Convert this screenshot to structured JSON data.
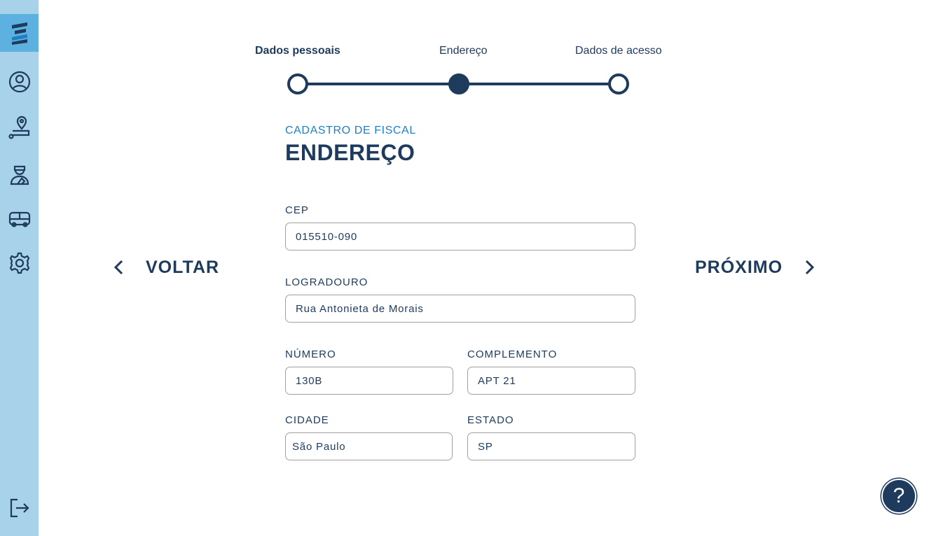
{
  "sidebar": {
    "items": [
      {
        "name": "logo",
        "icon": "brand-logo-icon"
      },
      {
        "name": "profile",
        "icon": "user-circle-icon"
      },
      {
        "name": "location",
        "icon": "map-pin-route-icon"
      },
      {
        "name": "inspector",
        "icon": "inspector-person-icon"
      },
      {
        "name": "bus",
        "icon": "bus-icon"
      },
      {
        "name": "settings",
        "icon": "gear-icon"
      },
      {
        "name": "logout",
        "icon": "logout-icon"
      }
    ]
  },
  "stepper": {
    "steps": [
      {
        "label": "Dados pessoais",
        "state": "completed"
      },
      {
        "label": "Endereço",
        "state": "current"
      },
      {
        "label": "Dados de acesso",
        "state": "upcoming"
      }
    ]
  },
  "form": {
    "subtitle": "CADASTRO DE FISCAL",
    "title": "ENDEREÇO",
    "fields": {
      "cep": {
        "label": "CEP",
        "value": "015510-090"
      },
      "logradouro": {
        "label": "LOGRADOURO",
        "value": "Rua Antonieta de Morais"
      },
      "numero": {
        "label": "NÚMERO",
        "value": "130B"
      },
      "complemento": {
        "label": "COMPLEMENTO",
        "value": "APT 21"
      },
      "cidade": {
        "label": "CIDADE",
        "value": "São Paulo"
      },
      "estado": {
        "label": "ESTADO",
        "value": "SP"
      }
    }
  },
  "nav": {
    "back_label": "VOLTAR",
    "next_label": "PRÓXIMO"
  },
  "help": {
    "label": "?"
  },
  "colors": {
    "primary": "#1e3a5c",
    "accent": "#1f7fc4",
    "sidebar_bg": "#a8d2ea",
    "sidebar_active": "#5cb1e0"
  }
}
